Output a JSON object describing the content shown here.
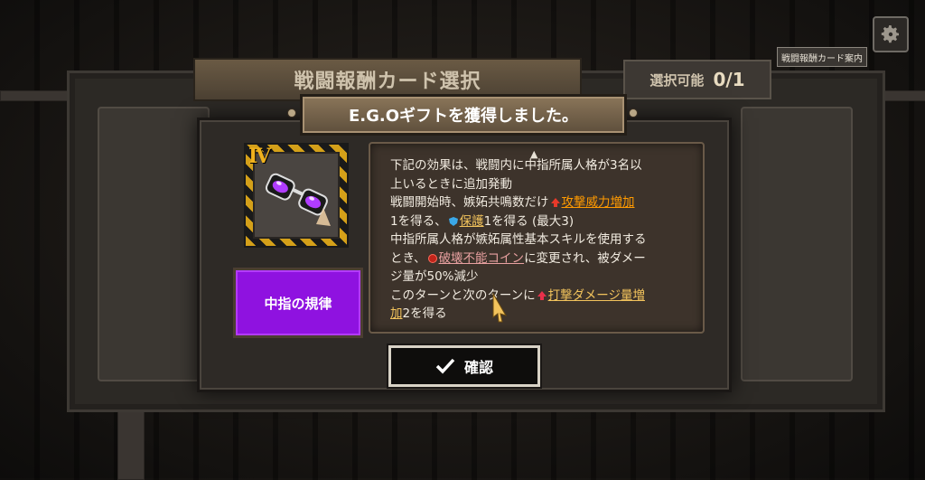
{
  "header": {
    "title": "戦闘報酬カード選択",
    "select_label": "選択可能",
    "select_count": "0/1"
  },
  "guide_button": "戦闘報酬カード案内",
  "dialog": {
    "title": "E.G.Oギフトを獲得しました。",
    "gift": {
      "tier": "Ⅳ",
      "name": "中指の規律"
    },
    "description": {
      "line1": "下記の効果は、戦闘内に中指所属人格が3名以",
      "line2": "上いるときに追加発動",
      "line3a": "戦闘開始時、嫉妬共鳴数だけ",
      "line3_highlight": "攻撃威力増加",
      "line4a": "1を得る、",
      "line4_highlight": "保護",
      "line4b": "1を得る (最大3)",
      "line5": "中指所属人格が嫉妬属性基本スキルを使用する",
      "line6a": "とき、",
      "line6_highlight": "破壊不能コイン",
      "line6b": "に変更され、被ダメー",
      "line7": "ジ量が50%減少",
      "line8a": "このターンと次のターンに",
      "line8_highlight": "打撃ダメージ量増",
      "line9_highlight": "加",
      "line9b": "2を得る"
    },
    "confirm_label": "確認"
  },
  "colors": {
    "gift_name_bg": "#8f12e0",
    "tier_gold": "#f0b21d"
  }
}
